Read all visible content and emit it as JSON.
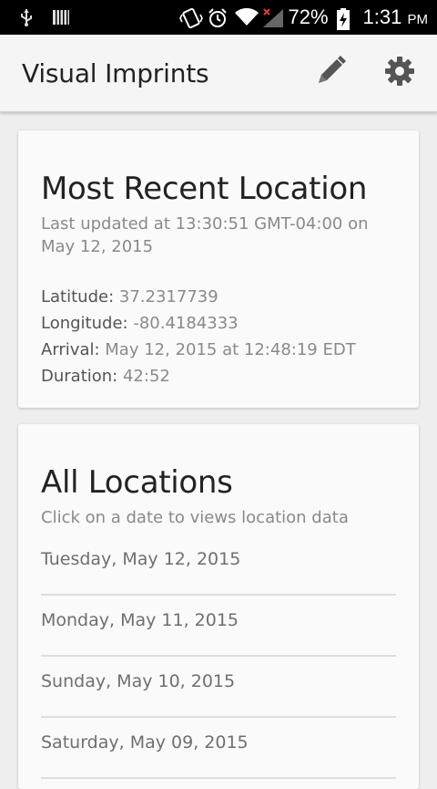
{
  "status_bar": {
    "battery_percent": "72%",
    "time": "1:31",
    "ampm": "PM",
    "left_icons": [
      "usb-icon",
      "barcode-icon"
    ],
    "right_icons": [
      "vibrate-icon",
      "alarm-icon",
      "wifi-icon",
      "signal-icon",
      "battery-charging-icon"
    ]
  },
  "app_bar": {
    "title": "Visual Imprints",
    "actions": [
      "pencil-icon",
      "gear-icon"
    ]
  },
  "recent": {
    "title": "Most Recent Location",
    "updated": "Last updated at 13:30:51 GMT-04:00 on May 12, 2015",
    "fields": [
      {
        "label": "Latitude:",
        "value": "37.2317739"
      },
      {
        "label": "Longitude:",
        "value": "-80.4184333"
      },
      {
        "label": "Arrival:",
        "value": "May 12, 2015 at 12:48:19 EDT"
      },
      {
        "label": "Duration:",
        "value": "42:52"
      }
    ]
  },
  "all": {
    "title": "All Locations",
    "hint": "Click on a date to views location data",
    "dates": [
      "Tuesday, May 12, 2015",
      "Monday, May 11, 2015",
      "Sunday, May 10, 2015",
      "Saturday, May 09, 2015"
    ]
  },
  "colors": {
    "status_bar_bg": "#000000",
    "app_bar_bg": "#f5f5f5",
    "page_bg": "#eeeeee",
    "card_bg": "#fafafa",
    "icon_gray": "#555555",
    "signal_x": "#e53935"
  }
}
